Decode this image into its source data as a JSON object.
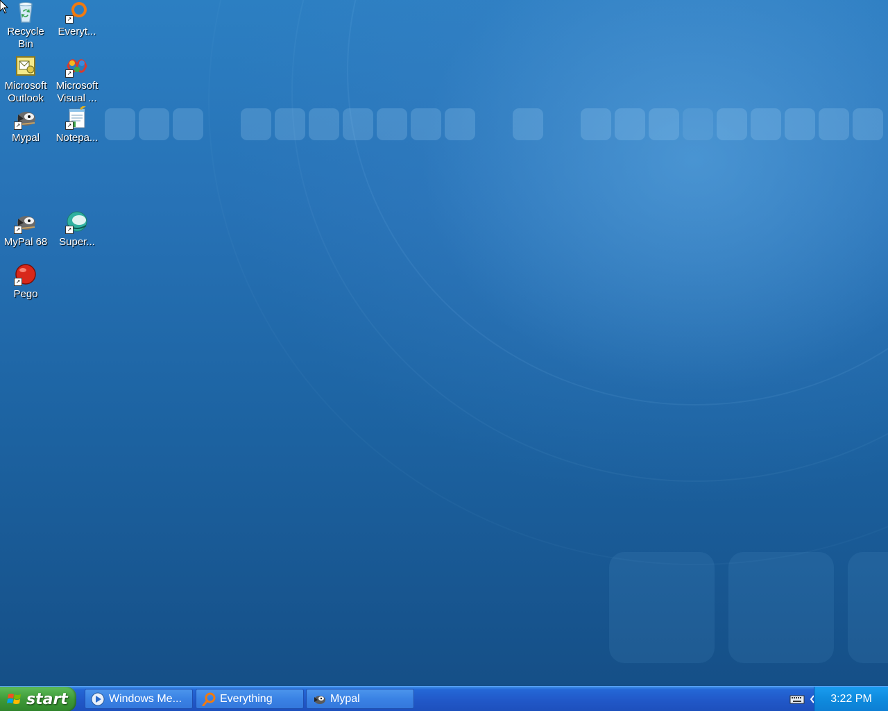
{
  "desktop": {
    "icons": [
      {
        "id": "recycle-bin",
        "label": "Recycle\nBin",
        "icon": "recycle-bin-icon"
      },
      {
        "id": "everything",
        "label": "Everyt...",
        "icon": "everything-icon"
      },
      {
        "id": "outlook",
        "label": "Microsoft\nOutlook",
        "icon": "outlook-icon"
      },
      {
        "id": "visual",
        "label": "Microsoft\nVisual ...",
        "icon": "visual-studio-icon"
      },
      {
        "id": "mypal",
        "label": "Mypal",
        "icon": "mypal-icon"
      },
      {
        "id": "notepad",
        "label": "Notepa...",
        "icon": "notepad-icon"
      },
      {
        "id": "mypal68",
        "label": "MyPal 68",
        "icon": "mypal68-icon"
      },
      {
        "id": "super",
        "label": "Super...",
        "icon": "super-icon"
      },
      {
        "id": "pego",
        "label": "Pego",
        "icon": "pego-icon"
      }
    ]
  },
  "taskbar": {
    "start_label": "start",
    "buttons": [
      {
        "label": "Windows Me...",
        "icon": "windows-media-player-icon"
      },
      {
        "label": "Everything",
        "icon": "everything-search-icon"
      },
      {
        "label": "Mypal",
        "icon": "mypal-icon"
      }
    ],
    "clock": "3:22 PM",
    "colors": {
      "start_green": "#3e9a38",
      "bar_blue": "#2158c8",
      "tray_blue": "#0f8bde"
    }
  }
}
